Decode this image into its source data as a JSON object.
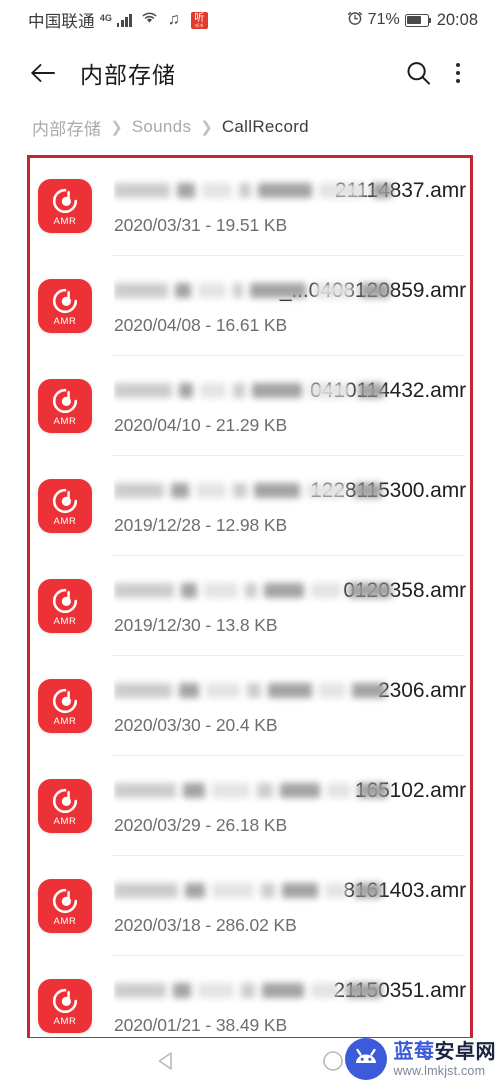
{
  "status_bar": {
    "carrier": "中国联通",
    "network": "4G",
    "icons": [
      "signal-icon",
      "wifi-icon",
      "music-note-icon",
      "ting-app-icon"
    ],
    "ting_label": "听",
    "alarm_icon": "alarm-icon",
    "battery_percent": "71%",
    "battery_level": 71,
    "clock": "20:08"
  },
  "app_bar": {
    "back_icon": "back-arrow-icon",
    "title": "内部存储",
    "search_icon": "search-icon",
    "overflow_icon": "more-vertical-icon"
  },
  "breadcrumb": {
    "separator": "❯",
    "items": [
      {
        "label": "内部存储",
        "active": false
      },
      {
        "label": "Sounds",
        "active": false
      },
      {
        "label": "CallRecord",
        "active": true
      }
    ]
  },
  "annotation": {
    "type": "red-highlight-rectangle",
    "color": "#c62631"
  },
  "file_list": {
    "icon_type": "AMR",
    "icon_color": "#ec3237",
    "files": [
      {
        "name_visible": "21114837.amr",
        "name_redacted": true,
        "date": "2020/03/31",
        "size": "19.51 KB",
        "meta": "2020/03/31 - 19.51 KB"
      },
      {
        "name_visible": "_...0408120859.amr",
        "name_redacted": true,
        "date": "2020/04/08",
        "size": "16.61 KB",
        "meta": "2020/04/08 - 16.61 KB"
      },
      {
        "name_visible": "0410114432.amr",
        "name_redacted": true,
        "date": "2020/04/10",
        "size": "21.29 KB",
        "meta": "2020/04/10 - 21.29 KB"
      },
      {
        "name_visible": "1228115300.amr",
        "name_redacted": true,
        "date": "2019/12/28",
        "size": "12.98 KB",
        "meta": "2019/12/28 - 12.98 KB"
      },
      {
        "name_visible": "0120358.amr",
        "name_redacted": true,
        "date": "2019/12/30",
        "size": "13.8 KB",
        "meta": "2019/12/30 - 13.8 KB"
      },
      {
        "name_visible": "2306.amr",
        "name_redacted": true,
        "date": "2020/03/30",
        "size": "20.4 KB",
        "meta": "2020/03/30 - 20.4 KB"
      },
      {
        "name_visible": "165102.amr",
        "name_redacted": true,
        "date": "2020/03/29",
        "size": "26.18 KB",
        "meta": "2020/03/29 - 26.18 KB"
      },
      {
        "name_visible": "8161403.amr",
        "name_redacted": true,
        "date": "2020/03/18",
        "size": "286.02 KB",
        "meta": "2020/03/18 - 286.02 KB"
      },
      {
        "name_visible": "21150351.amr",
        "name_redacted": true,
        "date": "2020/01/21",
        "size": "38.49 KB",
        "meta": "2020/01/21 - 38.49 KB"
      }
    ]
  },
  "nav_bar": {
    "back": "nav-back-icon",
    "home": "nav-home-icon"
  },
  "watermark": {
    "logo": "android-mascot-icon",
    "name_part1": "蓝莓",
    "name_part2": "安卓网",
    "url": "www.lmkjst.com",
    "brand_color": "#3b5bdb"
  }
}
